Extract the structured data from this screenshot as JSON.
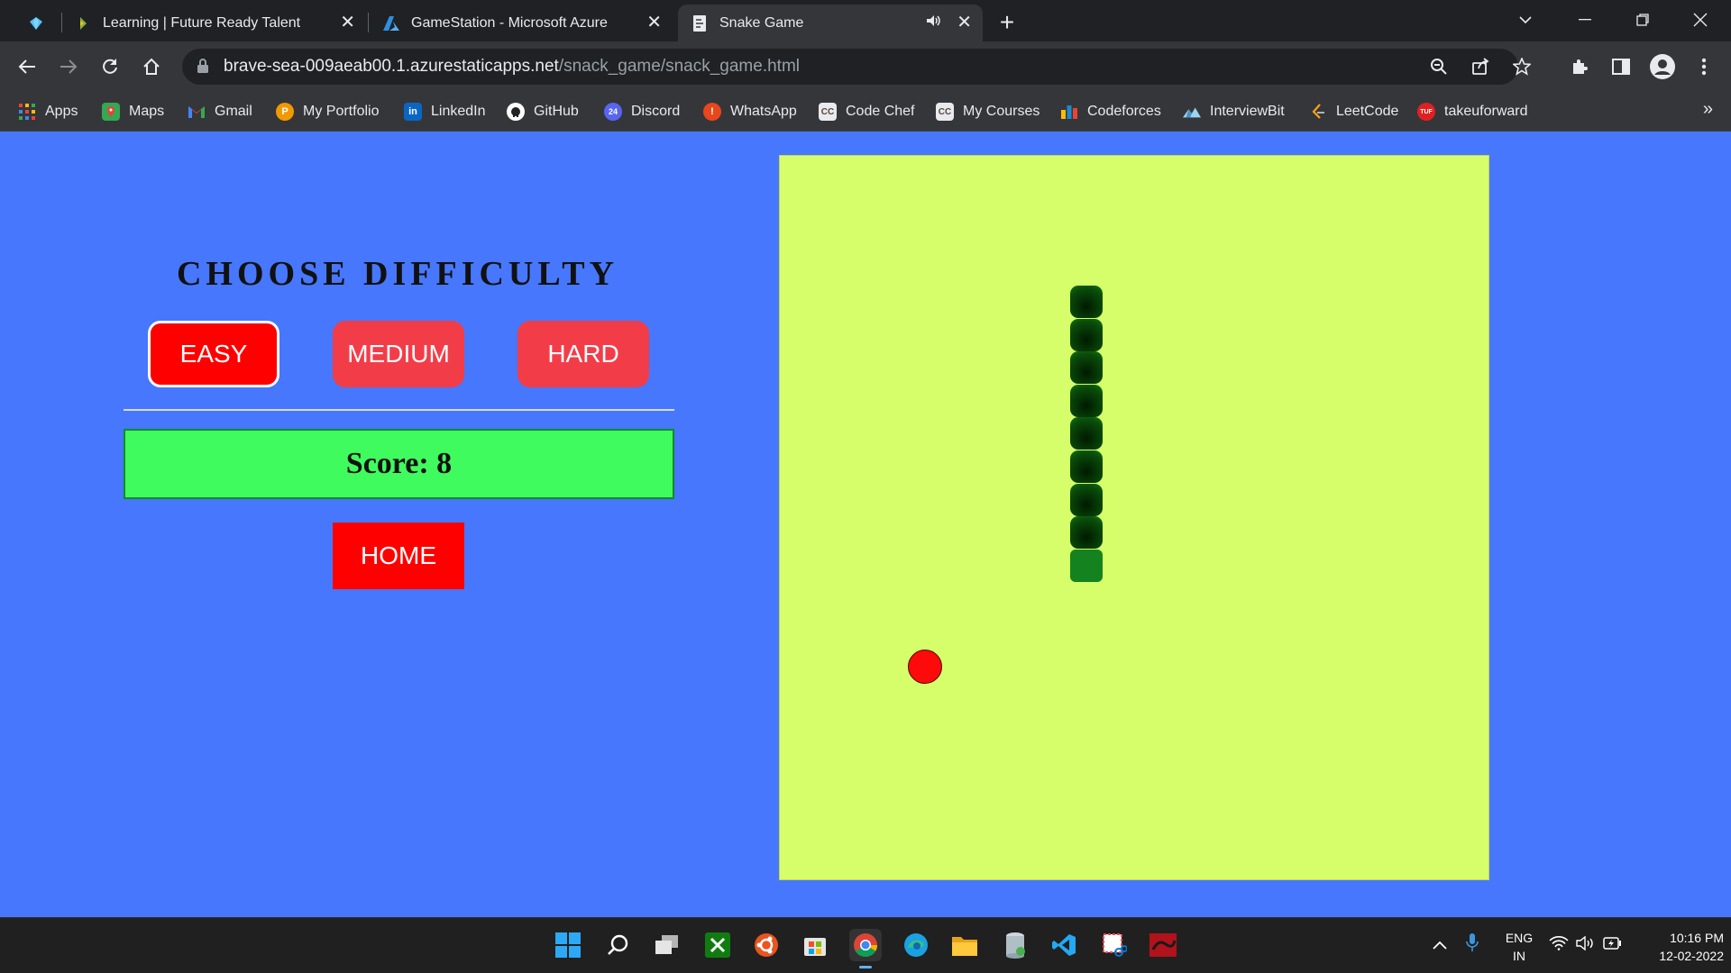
{
  "browser": {
    "tabs": [
      {
        "title": "",
        "icon": "diamond-icon"
      },
      {
        "title": "Learning | Future Ready Talent",
        "icon": "future-ready-icon"
      },
      {
        "title": "GameStation - Microsoft Azure",
        "icon": "azure-icon"
      },
      {
        "title": "Snake Game",
        "icon": "page-icon",
        "active": true,
        "audio": true
      }
    ],
    "url": {
      "host": "brave-sea-009aeab00.1.azurestaticapps.net",
      "path": "/snack_game/snack_game.html"
    },
    "bookmarks": [
      {
        "label": "Apps",
        "icon": "apps-grid-icon",
        "color": "#ea4335"
      },
      {
        "label": "Maps",
        "icon": "maps-icon",
        "color": "#34a853"
      },
      {
        "label": "Gmail",
        "icon": "gmail-icon",
        "color": "#ea4335"
      },
      {
        "label": "My Portfolio",
        "icon": "portfolio-icon",
        "color": "#f29900"
      },
      {
        "label": "LinkedIn",
        "icon": "linkedin-icon",
        "color": "#0a66c2"
      },
      {
        "label": "GitHub",
        "icon": "github-icon",
        "color": "#ffffff"
      },
      {
        "label": "Discord",
        "icon": "discord-icon",
        "color": "#5865f2"
      },
      {
        "label": "WhatsApp",
        "icon": "whatsapp-icon",
        "color": "#e8461b"
      },
      {
        "label": "Code Chef",
        "icon": "codechef-icon",
        "color": "#5b4638"
      },
      {
        "label": "My Courses",
        "icon": "codechef-icon",
        "color": "#5b4638"
      },
      {
        "label": "Codeforces",
        "icon": "codeforces-icon",
        "color": "#1f8acb"
      },
      {
        "label": "InterviewBit",
        "icon": "interviewbit-icon",
        "color": "#9bd3f0"
      },
      {
        "label": "LeetCode",
        "icon": "leetcode-icon",
        "color": "#ffa116"
      },
      {
        "label": "takeuforward",
        "icon": "tuf-icon",
        "color": "#e02020"
      }
    ]
  },
  "game": {
    "difficulty_title": "CHOOSE DIFFICULTY",
    "buttons": {
      "easy": "EASY",
      "medium": "MEDIUM",
      "hard": "HARD"
    },
    "selected_difficulty": "easy",
    "score_label": "Score: 8",
    "home_label": "HOME",
    "snake_segments": 9,
    "colors": {
      "page_background": "#4777fc",
      "board": "#d6fe6a",
      "score_box": "#40fb5e",
      "button": "#f23d49",
      "button_selected": "#ff0000",
      "food": "#ff0a0a",
      "snake": "#0a4d0a"
    }
  },
  "taskbar": {
    "language": "ENG",
    "region": "IN",
    "time": "10:16 PM",
    "date": "12-02-2022",
    "apps": [
      "windows-start-icon",
      "search-icon",
      "task-view-icon",
      "xbox-icon",
      "ubuntu-icon",
      "store-icon",
      "chrome-icon",
      "edge-icon",
      "file-explorer-icon",
      "notepad-icon",
      "vscode-icon",
      "snipping-tool-icon",
      "app-icon"
    ]
  }
}
